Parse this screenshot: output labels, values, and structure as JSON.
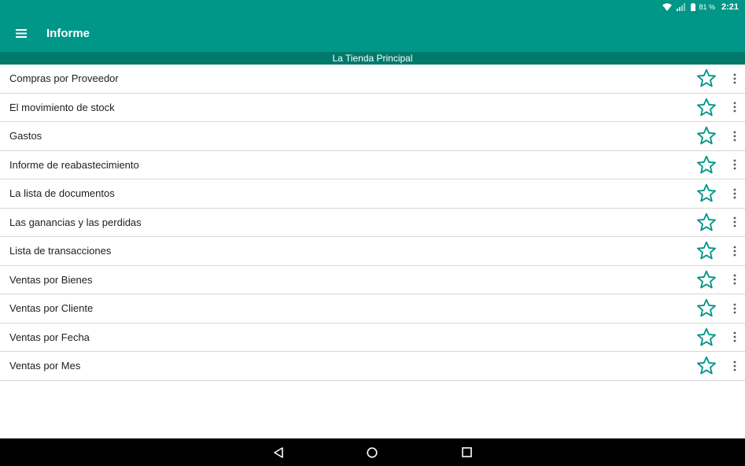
{
  "status_bar": {
    "battery": "81 %",
    "time": "2:21",
    "icons": [
      "wifi-icon",
      "signal-icon",
      "battery-icon"
    ]
  },
  "app_bar": {
    "title": "Informe",
    "menu_icon": "hamburger-menu-icon"
  },
  "store": {
    "name": "La Tienda Principal"
  },
  "reports": [
    {
      "label": "Compras por Proveedor"
    },
    {
      "label": "El movimiento de stock"
    },
    {
      "label": "Gastos"
    },
    {
      "label": "Informe de reabastecimiento"
    },
    {
      "label": "La lista de documentos"
    },
    {
      "label": "Las ganancias y las perdidas"
    },
    {
      "label": "Lista de transacciones"
    },
    {
      "label": "Ventas por Bienes"
    },
    {
      "label": "Ventas por Cliente"
    },
    {
      "label": "Ventas por Fecha"
    },
    {
      "label": "Ventas por Mes"
    }
  ],
  "colors": {
    "primary": "#009688",
    "primary_dark": "#00796b",
    "star_outline": "#009688",
    "divider": "#d6d6d6",
    "nav_bar": "#000000"
  },
  "nav_bar": {
    "icons": [
      "back-icon",
      "home-icon",
      "recent-apps-icon"
    ]
  }
}
